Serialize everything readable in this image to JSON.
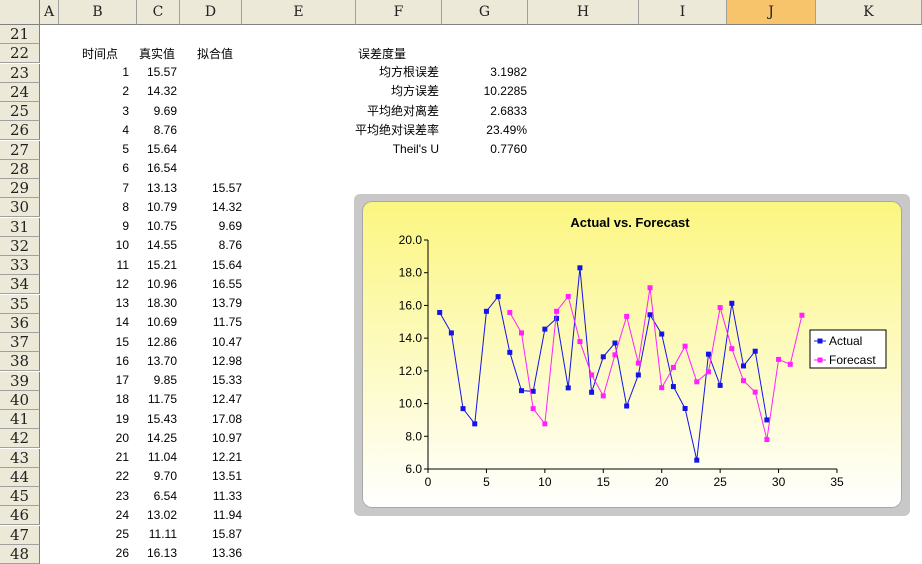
{
  "columns": [
    "A",
    "B",
    "C",
    "D",
    "E",
    "F",
    "G",
    "H",
    "I",
    "J",
    "K"
  ],
  "selected_column": "J",
  "rows": [
    "21",
    "22",
    "23",
    "24",
    "25",
    "26",
    "27",
    "28",
    "29",
    "30",
    "31",
    "32",
    "33",
    "34",
    "35",
    "36",
    "37",
    "38",
    "39",
    "40",
    "41",
    "42",
    "43",
    "44",
    "45",
    "46",
    "47",
    "48"
  ],
  "table": {
    "headers": {
      "time": "时间点",
      "actual": "真实值",
      "fitted": "拟合值"
    },
    "time": [
      "1",
      "2",
      "3",
      "4",
      "5",
      "6",
      "7",
      "8",
      "9",
      "10",
      "11",
      "12",
      "13",
      "14",
      "15",
      "16",
      "17",
      "18",
      "19",
      "20",
      "21",
      "22",
      "23",
      "24",
      "25",
      "26"
    ],
    "actual": [
      "15.57",
      "14.32",
      "9.69",
      "8.76",
      "15.64",
      "16.54",
      "13.13",
      "10.79",
      "10.75",
      "14.55",
      "15.21",
      "10.96",
      "18.30",
      "10.69",
      "12.86",
      "13.70",
      "9.85",
      "11.75",
      "15.43",
      "14.25",
      "11.04",
      "9.70",
      "6.54",
      "13.02",
      "11.11",
      "16.13"
    ],
    "fitted": [
      "",
      "",
      "",
      "",
      "",
      "",
      "15.57",
      "14.32",
      "9.69",
      "8.76",
      "15.64",
      "16.55",
      "13.79",
      "11.75",
      "10.47",
      "12.98",
      "15.33",
      "12.47",
      "17.08",
      "10.97",
      "12.21",
      "13.51",
      "11.33",
      "11.94",
      "15.87",
      "13.36"
    ]
  },
  "metrics": {
    "title": "误差度量",
    "items": [
      {
        "label": "均方根误差",
        "value": "3.1982"
      },
      {
        "label": "均方误差",
        "value": "10.2285"
      },
      {
        "label": "平均绝对离差",
        "value": "2.6833"
      },
      {
        "label": "平均绝对误差率",
        "value": "23.49%"
      },
      {
        "label": "Theil's U",
        "value": "0.7760"
      }
    ]
  },
  "chart_data": {
    "type": "line",
    "title": "Actual vs. Forecast",
    "xlim": [
      0,
      35
    ],
    "ylim": [
      6.0,
      20.0
    ],
    "x_ticks": [
      "0",
      "5",
      "10",
      "15",
      "20",
      "25",
      "30",
      "35"
    ],
    "y_ticks": [
      "6.0",
      "8.0",
      "10.0",
      "12.0",
      "14.0",
      "16.0",
      "18.0",
      "20.0"
    ],
    "legend_position": "right",
    "series": [
      {
        "name": "Actual",
        "color": "#1414e6",
        "x": [
          1,
          2,
          3,
          4,
          5,
          6,
          7,
          8,
          9,
          10,
          11,
          12,
          13,
          14,
          15,
          16,
          17,
          18,
          19,
          20,
          21,
          22,
          23,
          24,
          25,
          26,
          27,
          28,
          29
        ],
        "y": [
          15.57,
          14.32,
          9.69,
          8.76,
          15.64,
          16.54,
          13.13,
          10.79,
          10.75,
          14.55,
          15.21,
          10.96,
          18.3,
          10.69,
          12.86,
          13.7,
          9.85,
          11.75,
          15.43,
          14.25,
          11.04,
          9.7,
          6.54,
          13.02,
          11.11,
          16.13,
          12.3,
          13.2,
          9.0
        ]
      },
      {
        "name": "Forecast",
        "color": "#ff22ff",
        "x": [
          7,
          8,
          9,
          10,
          11,
          12,
          13,
          14,
          15,
          16,
          17,
          18,
          19,
          20,
          21,
          22,
          23,
          24,
          25,
          26,
          27,
          28,
          29,
          30,
          31,
          32
        ],
        "y": [
          15.57,
          14.32,
          9.69,
          8.76,
          15.64,
          16.55,
          13.79,
          11.75,
          10.47,
          12.98,
          15.33,
          12.47,
          17.08,
          10.97,
          12.21,
          13.51,
          11.33,
          11.94,
          15.87,
          13.36,
          11.4,
          10.7,
          7.8,
          12.7,
          12.4,
          15.4
        ]
      }
    ]
  }
}
